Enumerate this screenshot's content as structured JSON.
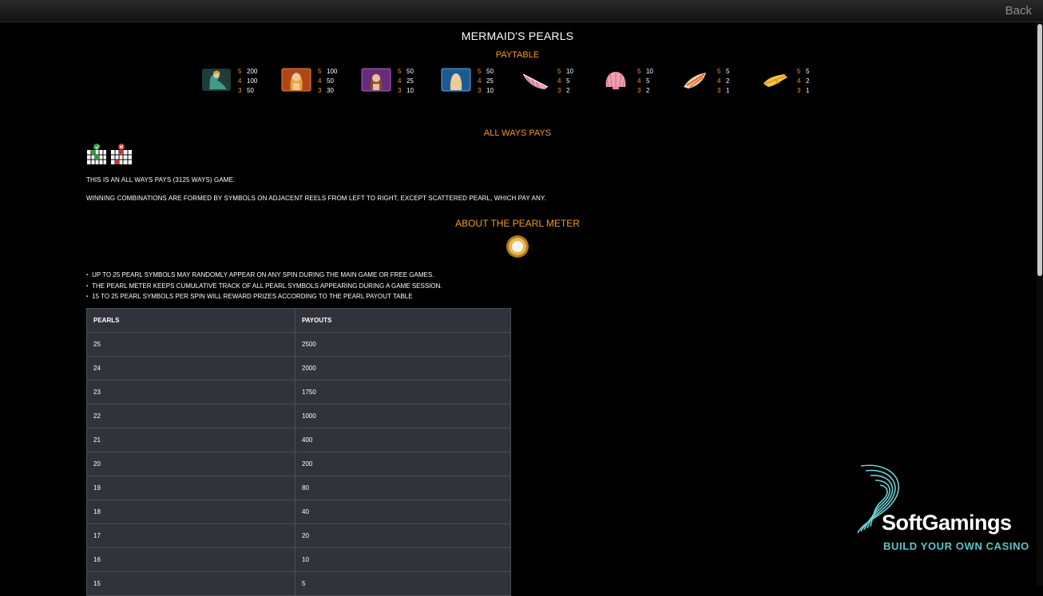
{
  "topbar": {
    "back_label": "Back"
  },
  "title": "MERMAID'S PEARLS",
  "paytable": {
    "heading": "PAYTABLE",
    "symbols": [
      {
        "icon": "mermaid-symbol-icon",
        "pays": [
          [
            "5",
            "200"
          ],
          [
            "4",
            "100"
          ],
          [
            "3",
            "50"
          ]
        ]
      },
      {
        "icon": "red-mermaid-symbol-icon",
        "pays": [
          [
            "5",
            "100"
          ],
          [
            "4",
            "50"
          ],
          [
            "3",
            "30"
          ]
        ]
      },
      {
        "icon": "purple-mermaid-symbol-icon",
        "pays": [
          [
            "5",
            "50"
          ],
          [
            "4",
            "25"
          ],
          [
            "3",
            "10"
          ]
        ]
      },
      {
        "icon": "blue-mermaid-symbol-icon",
        "pays": [
          [
            "5",
            "50"
          ],
          [
            "4",
            "25"
          ],
          [
            "3",
            "10"
          ]
        ]
      },
      {
        "icon": "conch-shell-icon",
        "pays": [
          [
            "5",
            "10"
          ],
          [
            "4",
            "5"
          ],
          [
            "3",
            "2"
          ]
        ]
      },
      {
        "icon": "scallop-shell-icon",
        "pays": [
          [
            "5",
            "10"
          ],
          [
            "4",
            "5"
          ],
          [
            "3",
            "2"
          ]
        ]
      },
      {
        "icon": "spiral-shell-icon",
        "pays": [
          [
            "5",
            "5"
          ],
          [
            "4",
            "2"
          ],
          [
            "3",
            "1"
          ]
        ]
      },
      {
        "icon": "starfish-shell-icon",
        "pays": [
          [
            "5",
            "5"
          ],
          [
            "4",
            "2"
          ],
          [
            "3",
            "1"
          ]
        ]
      }
    ]
  },
  "ways": {
    "heading": "ALL WAYS PAYS",
    "line1": "THIS IS AN ALL WAYS PAYS (3125 WAYS) GAME.",
    "line2": "WINNING COMBINATIONS ARE FORMED BY SYMBOLS ON ADJACENT REELS FROM LEFT TO RIGHT, EXCEPT SCATTERED PEARL, WHICH PAY ANY."
  },
  "pearl_meter": {
    "heading": "ABOUT THE PEARL METER",
    "bullets": [
      "UP TO 25 PEARL SYMBOLS MAY RANDOMLY APPEAR ON ANY SPIN DURING THE MAIN GAME OR FREE GAMES.",
      "THE PEARL METER KEEPS CUMULATIVE TRACK OF ALL PEARL SYMBOLS APPEARING DURING A GAME SESSION.",
      "15 TO 25 PEARL SYMBOLS PER SPIN WILL REWARD PRIZES ACCORDING TO THE PEARL PAYOUT TABLE"
    ],
    "table": {
      "headers": [
        "PEARLS",
        "PAYOUTS"
      ],
      "rows": [
        [
          "25",
          "2500"
        ],
        [
          "24",
          "2000"
        ],
        [
          "23",
          "1750"
        ],
        [
          "22",
          "1000"
        ],
        [
          "21",
          "400"
        ],
        [
          "20",
          "200"
        ],
        [
          "19",
          "80"
        ],
        [
          "18",
          "40"
        ],
        [
          "17",
          "20"
        ],
        [
          "16",
          "10"
        ],
        [
          "15",
          "5"
        ]
      ]
    }
  },
  "logo": {
    "brand": "SoftGamings",
    "tagline": "BUILD YOUR OWN CASINO"
  },
  "colors": {
    "accent": "#f59a1f",
    "table_bg": "#30343a",
    "brand_teal": "#5ec4c8"
  }
}
